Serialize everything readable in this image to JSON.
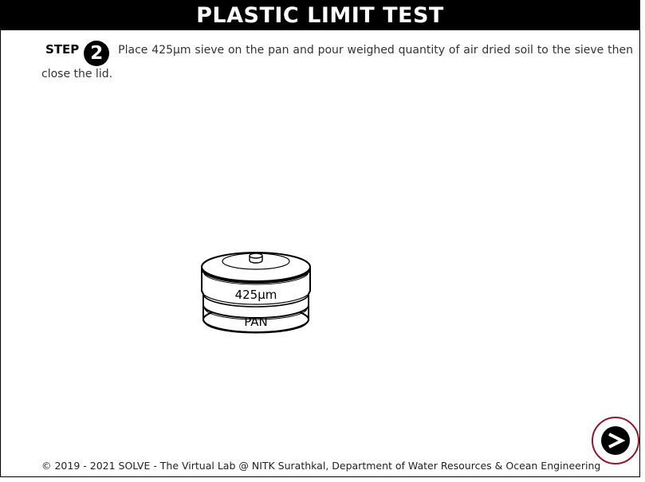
{
  "header": {
    "title": "PLASTIC LIMIT TEST"
  },
  "step": {
    "label": "STEP",
    "number": "2",
    "instruction": "Place 425µm sieve on the pan and pour weighed quantity of air dried soil to the sieve then close the lid."
  },
  "apparatus": {
    "sieve_label": "425µm",
    "pan_label": "PAN"
  },
  "navigation": {
    "next_icon": "next-arrow-icon",
    "accent_color": "#8b1a2b"
  },
  "footer": {
    "copyright": "© 2019 - 2021 SOLVE - The Virtual Lab @ NITK Surathkal, Department of Water Resources & Ocean Engineering"
  }
}
